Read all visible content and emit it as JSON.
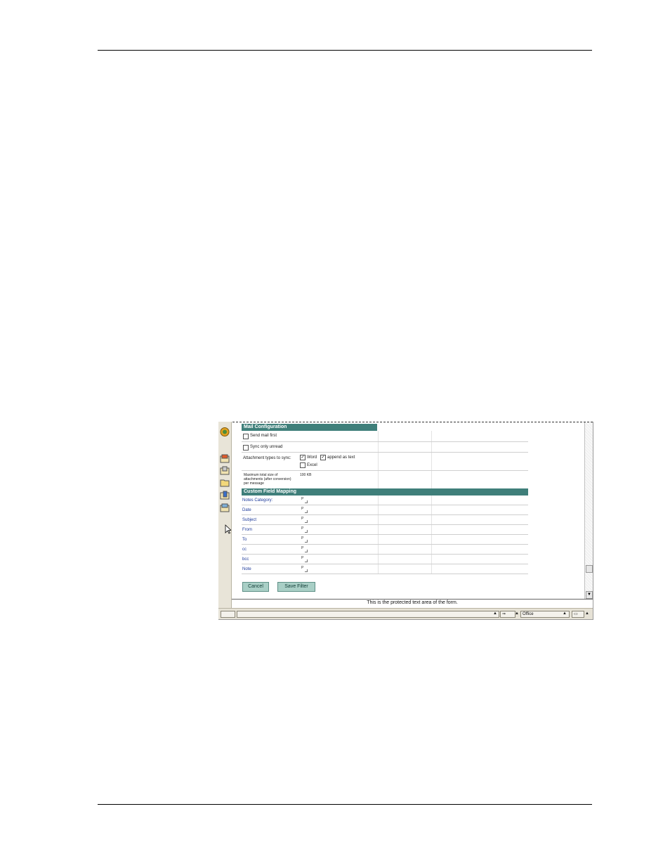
{
  "mail_configuration": {
    "header": "Mail Configuration",
    "send_mail_first": "Send mail first",
    "sync_only_unread": "Sync only unread",
    "attachment_types_label": "Attachment types to sync:",
    "word": "Word",
    "append_as_text": "append as text",
    "excel": "Excel",
    "max_size_label": "Maximum total size of attachments (after conversion) per message",
    "max_size_value": "100",
    "max_size_unit": "KB",
    "send_mail_first_checked": false,
    "sync_only_unread_checked": false,
    "word_checked": true,
    "append_as_text_checked": true,
    "excel_checked": false
  },
  "custom_field_mapping": {
    "header": "Custom Field Mapping",
    "fields": [
      {
        "label": "Notes Category:"
      },
      {
        "label": "Date"
      },
      {
        "label": "Subject"
      },
      {
        "label": "From"
      },
      {
        "label": "To"
      },
      {
        "label": "cc"
      },
      {
        "label": "bcc"
      },
      {
        "label": "Note"
      }
    ],
    "field_mark": "P"
  },
  "buttons": {
    "cancel": "Cancel",
    "save_filter": "Save Filter"
  },
  "protected_area_text": "This is the protected text area of the form.",
  "status_bar": {
    "location": "Office"
  },
  "colors": {
    "section_header": "#3f7f7a",
    "button": "#a9cfc6",
    "link": "#1d3a9a"
  }
}
